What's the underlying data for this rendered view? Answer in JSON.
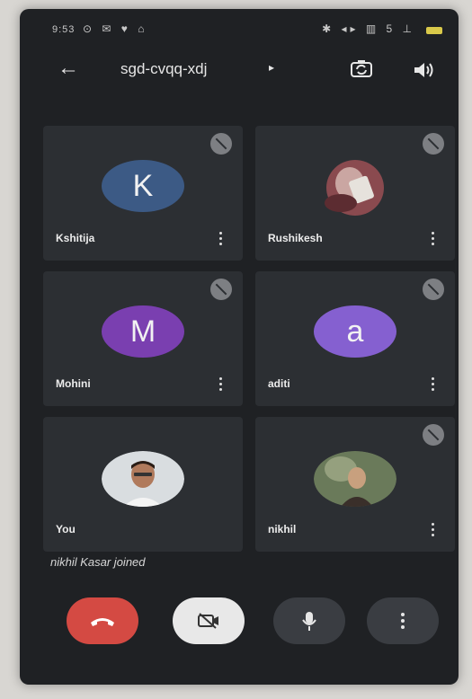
{
  "status_bar": {
    "time": "9:53",
    "left_icons": "⊙ ✉ ♥ ⌂",
    "right_icons": "✱ ◂▸ ▥ 5 ⊥"
  },
  "header": {
    "meeting_code": "sgd-cvqq-xdj",
    "caret": "▸"
  },
  "participants": [
    {
      "name": "Kshitija",
      "initial": "K",
      "avatar_color": "#3c5a85"
    },
    {
      "name": "Rushikesh",
      "initial": "",
      "avatar_color": "#6b3b3f"
    },
    {
      "name": "Mohini",
      "initial": "M",
      "avatar_color": "#7a3fb0"
    },
    {
      "name": "aditi",
      "initial": "a",
      "avatar_color": "#8560d0"
    },
    {
      "name": "You",
      "initial": "",
      "avatar_color": "#cfd4d8"
    },
    {
      "name": "nikhil",
      "initial": "",
      "avatar_color": "#5e6b52"
    }
  ],
  "toast": "nikhil Kasar joined",
  "colors": {
    "background": "#1f2124",
    "tile": "#2c2f33",
    "end_call": "#d44a43",
    "camera_off": "#e8e8e8"
  },
  "controls": [
    "end-call",
    "camera-off",
    "microphone",
    "more-options"
  ]
}
